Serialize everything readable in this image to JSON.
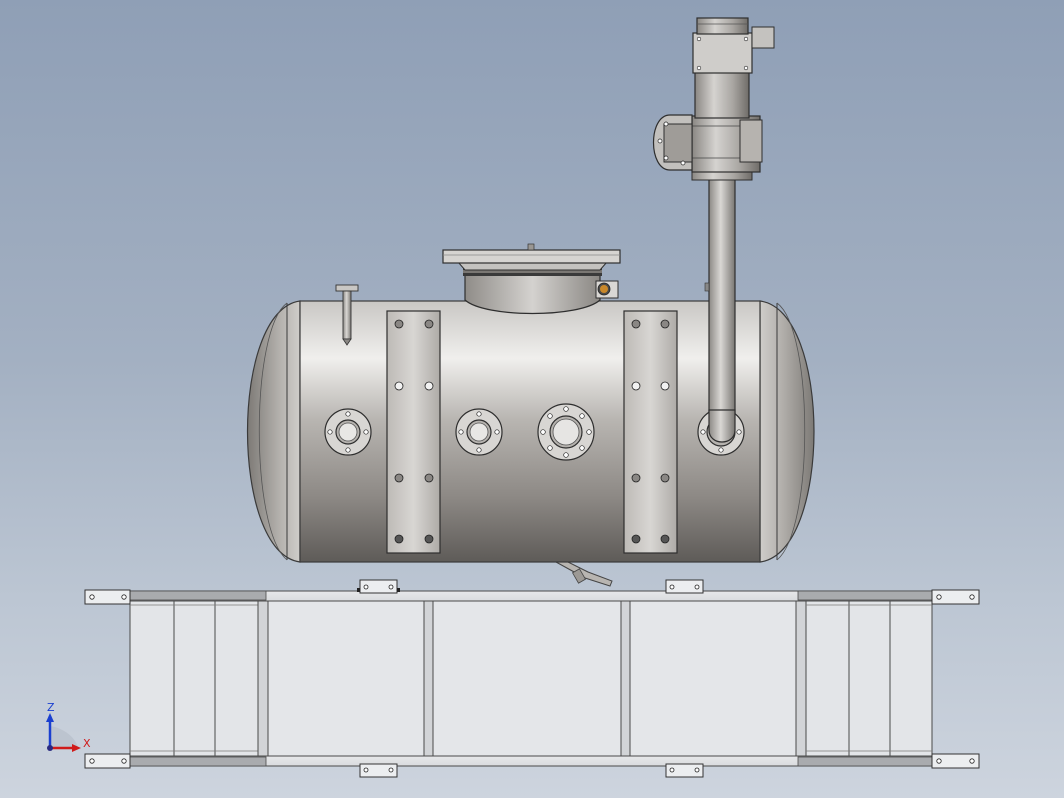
{
  "triad": {
    "z_label": "Z",
    "x_label": "X",
    "z_color": "#1a3fd0",
    "x_color": "#d01a1a",
    "origin_color": "#2a2a80"
  },
  "colors": {
    "background_top": "#8f9fb6",
    "background_bottom": "#cdd4de",
    "metal_light": "#e6e5e3",
    "metal_dark": "#6b6865",
    "frame": "#e4e6e9",
    "frame_edge": "#4a4a4a",
    "sight_glass": "#c9882a"
  },
  "components": {
    "tank": "horizontal-pressure-vessel",
    "skid": "base-frame",
    "pump": "vertical-pump-motor"
  }
}
